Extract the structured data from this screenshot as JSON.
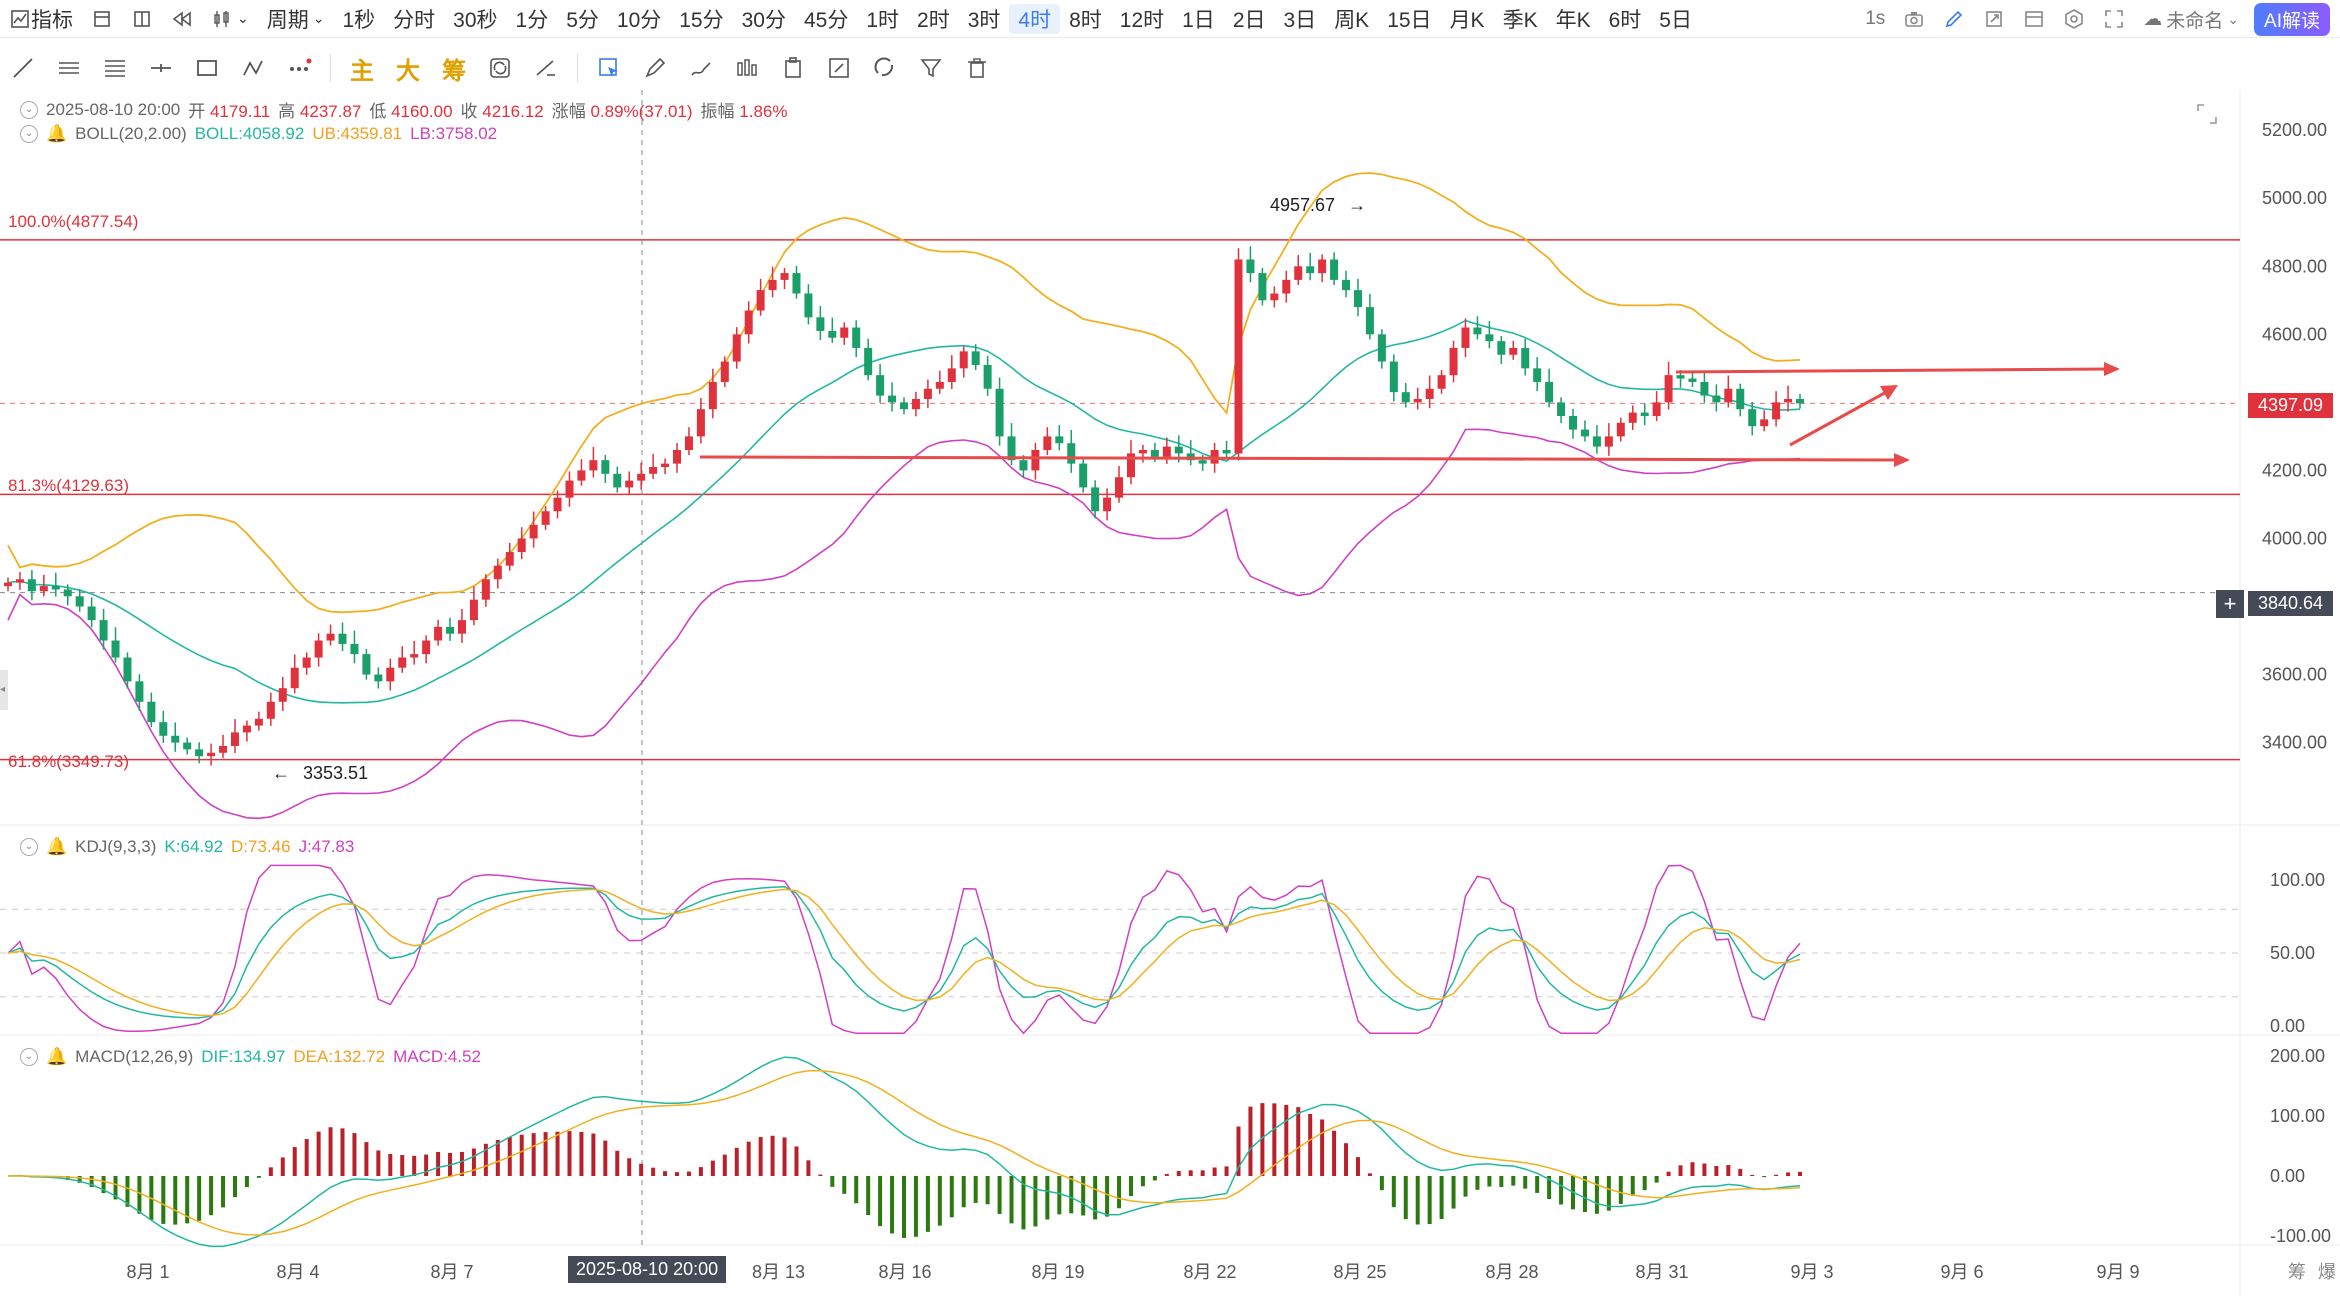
{
  "toolbar": {
    "indicators_label": "指标",
    "period_label": "周期",
    "periods": [
      "1秒",
      "分时",
      "30秒",
      "1分",
      "5分",
      "10分",
      "15分",
      "30分",
      "45分",
      "1时",
      "2时",
      "3时",
      "4时",
      "8时",
      "12时",
      "1日",
      "2日",
      "3日",
      "周K",
      "15日",
      "月K",
      "季K",
      "年K",
      "6时",
      "5日"
    ],
    "active_period": "4时",
    "refresh_label": "1s",
    "layout_name": "未命名",
    "ai_label": "AI解读"
  },
  "draw_tools": {
    "zhu": "主",
    "da": "大",
    "chou": "筹"
  },
  "ohlc": {
    "date": "2025-08-10 20:00",
    "open_label": "开",
    "open": "4179.11",
    "high_label": "高",
    "high": "4237.87",
    "low_label": "低",
    "low": "4160.00",
    "close_label": "收",
    "close": "4216.12",
    "change_label": "涨幅",
    "change": "0.89%(37.01)",
    "amp_label": "振幅",
    "amp": "1.86%"
  },
  "boll": {
    "name": "BOLL(20,2.00)",
    "boll": "BOLL:4058.92",
    "ub": "UB:4359.81",
    "lb": "LB:3758.02"
  },
  "kdj": {
    "name": "KDJ(9,3,3)",
    "k": "K:64.92",
    "d": "D:73.46",
    "j": "J:47.83"
  },
  "macd": {
    "name": "MACD(12,26,9)",
    "dif": "DIF:134.97",
    "dea": "DEA:132.72",
    "macd": "MACD:4.52"
  },
  "fib": {
    "f100": "100.0%(4877.54)",
    "f813": "81.3%(4129.63)",
    "f618": "61.8%(3349.73)"
  },
  "annotations": {
    "high": "4957.67",
    "low": "3353.51"
  },
  "price_axis": [
    "5200.00",
    "5000.00",
    "4800.00",
    "4600.00",
    "4400.00",
    "4200.00",
    "4000.00",
    "3800.00",
    "3600.00",
    "3400.00"
  ],
  "kdj_axis": [
    "100.00",
    "50.00",
    "0.00"
  ],
  "macd_axis": [
    "200.00",
    "100.00",
    "0.00",
    "-100.00"
  ],
  "current_price": "4397.09",
  "crosshair_price": "3840.64",
  "x_axis": [
    "8月 1",
    "8月 4",
    "8月 7",
    "8月 13",
    "8月 16",
    "8月 19",
    "8月 22",
    "8月 25",
    "8月 28",
    "8月 31",
    "9月 3",
    "9月 6",
    "9月 9"
  ],
  "crosshair_date": "2025-08-10 20:00",
  "bottom_right": {
    "a": "筹",
    "b": "爆"
  },
  "colors": {
    "up": "#e0323c",
    "down": "#1a9e6a",
    "ma": "#22b8a0",
    "ub": "#f0b020",
    "lb": "#d040c0",
    "accent": "#3a7bf0"
  },
  "chart_data": {
    "type": "candlestick",
    "ylim": [
      3290,
      5230
    ],
    "series_note": "4h candles, approximated",
    "close": [
      3870,
      3880,
      3845,
      3860,
      3850,
      3830,
      3800,
      3760,
      3700,
      3650,
      3580,
      3520,
      3460,
      3420,
      3400,
      3380,
      3360,
      3370,
      3390,
      3430,
      3450,
      3470,
      3520,
      3560,
      3620,
      3650,
      3700,
      3720,
      3690,
      3660,
      3600,
      3580,
      3620,
      3650,
      3660,
      3700,
      3740,
      3720,
      3760,
      3820,
      3880,
      3920,
      3960,
      4000,
      4040,
      4080,
      4120,
      4170,
      4200,
      4230,
      4190,
      4150,
      4170,
      4190,
      4210,
      4220,
      4260,
      4300,
      4380,
      4460,
      4520,
      4600,
      4670,
      4730,
      4760,
      4780,
      4720,
      4650,
      4610,
      4590,
      4620,
      4560,
      4480,
      4420,
      4400,
      4380,
      4410,
      4440,
      4460,
      4500,
      4550,
      4510,
      4440,
      4300,
      4230,
      4200,
      4260,
      4300,
      4280,
      4220,
      4150,
      4080,
      4120,
      4180,
      4250,
      4260,
      4240,
      4270,
      4250,
      4230,
      4220,
      4260,
      4250,
      4820,
      4780,
      4700,
      4720,
      4760,
      4800,
      4780,
      4820,
      4760,
      4730,
      4680,
      4600,
      4520,
      4430,
      4400,
      4410,
      4440,
      4480,
      4560,
      4620,
      4600,
      4580,
      4540,
      4560,
      4500,
      4460,
      4400,
      4360,
      4320,
      4300,
      4270,
      4300,
      4340,
      4370,
      4360,
      4400,
      4480,
      4470,
      4460,
      4420,
      4400,
      4440,
      4380,
      4330,
      4350,
      4400,
      4410,
      4397
    ]
  }
}
